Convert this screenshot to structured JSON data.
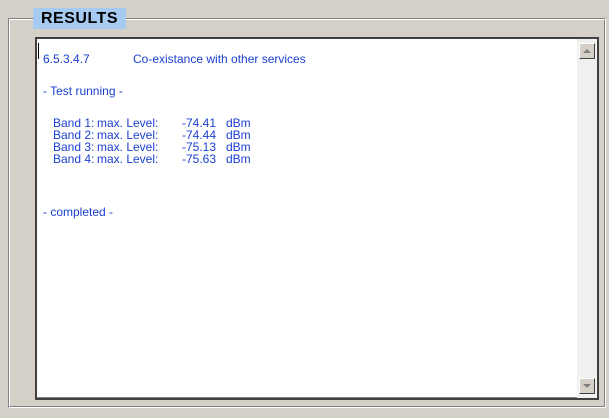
{
  "group": {
    "title": "RESULTS"
  },
  "results": {
    "heading_number": "6.5.3.4.7",
    "heading_title": "Co-existance with other services",
    "status_running": "- Test running -",
    "bands": [
      {
        "label": "Band 1:",
        "level_label": "max. Level:",
        "value": "-74.41",
        "unit": "dBm"
      },
      {
        "label": "Band 2:",
        "level_label": "max. Level:",
        "value": "-74.44",
        "unit": "dBm"
      },
      {
        "label": "Band 3:",
        "level_label": "max. Level:",
        "value": "-75.13",
        "unit": "dBm"
      },
      {
        "label": "Band 4:",
        "level_label": "max. Level:",
        "value": "-75.63",
        "unit": "dBm"
      }
    ],
    "status_completed": "- completed -"
  },
  "scrollbar": {
    "up_icon": "scroll-up-arrow-icon",
    "down_icon": "scroll-down-arrow-icon"
  }
}
